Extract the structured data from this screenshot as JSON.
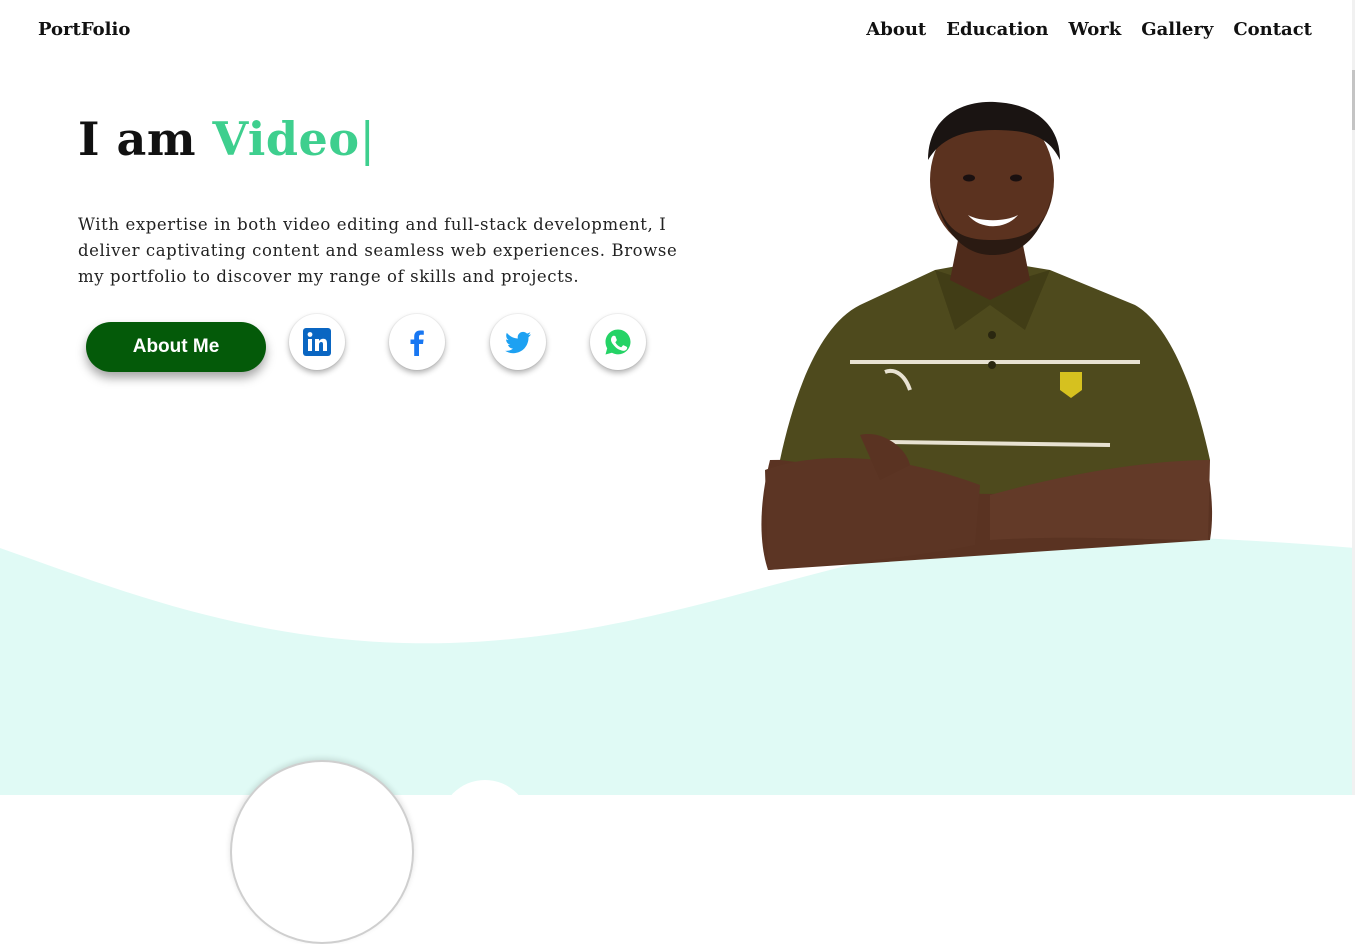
{
  "nav": {
    "brand": "PortFolio",
    "items": [
      "About",
      "Education",
      "Work",
      "Gallery",
      "Contact"
    ]
  },
  "hero": {
    "prefix": "I am",
    "typed": "Video",
    "cursor": "|",
    "description": "With expertise in both video editing and full-stack development, I deliver captivating content and seamless web experiences. Browse my portfolio to discover my range of skills and projects.",
    "cta_label": "About Me"
  },
  "social": [
    {
      "name": "linkedin-icon",
      "color": "#0a66c2"
    },
    {
      "name": "facebook-icon",
      "color": "#1877f2"
    },
    {
      "name": "twitter-icon",
      "color": "#1da1f2"
    },
    {
      "name": "whatsapp-icon",
      "color": "#25d366"
    }
  ],
  "colors": {
    "accent": "#3ecf8e",
    "cta_bg": "#045a09",
    "wave": "#e0faf5",
    "shirt": "#4e4a1d"
  }
}
